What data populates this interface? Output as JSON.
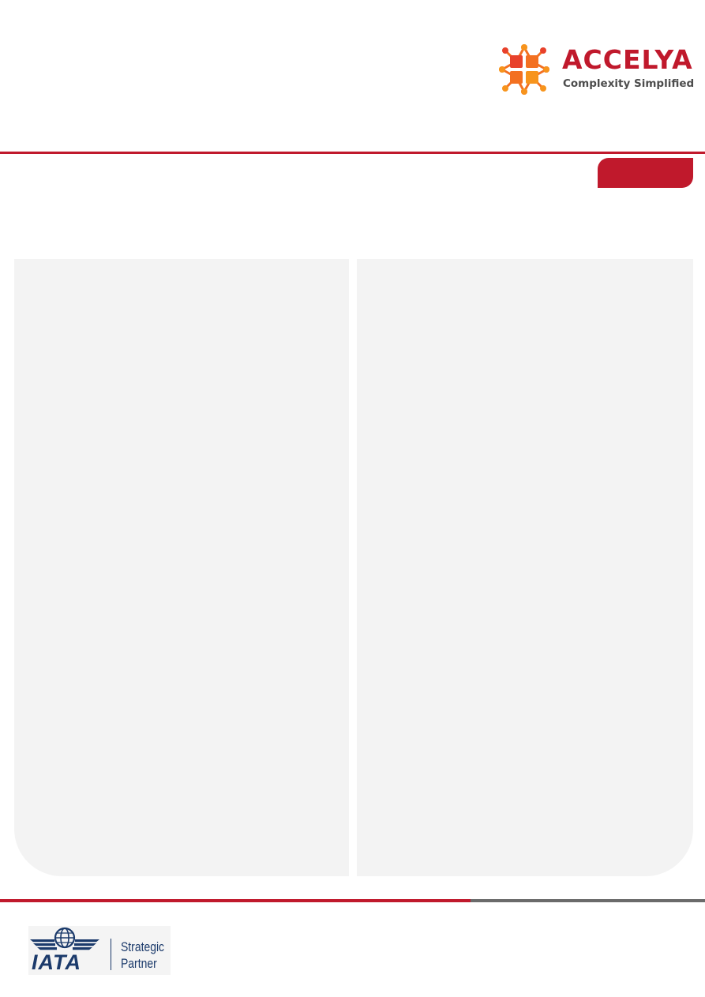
{
  "brand": {
    "name": "ACCELYA",
    "tagline": "Complexity Simplified"
  },
  "partner": {
    "name": "IATA",
    "label_line1": "Strategic",
    "label_line2": "Partner"
  },
  "colors": {
    "accent_red": "#c0192c",
    "logo_orange": "#f37021",
    "logo_red": "#e8412b",
    "logo_amber": "#f7941d",
    "tagline": "#4d4d4d",
    "panel_bg": "#f3f3f3",
    "footer_grey": "#6b6b6b",
    "iata_blue": "#1b3a6b"
  },
  "icons": {
    "brand_mark": "accelya-molecule-icon",
    "partner_mark": "iata-winged-globe-icon"
  }
}
